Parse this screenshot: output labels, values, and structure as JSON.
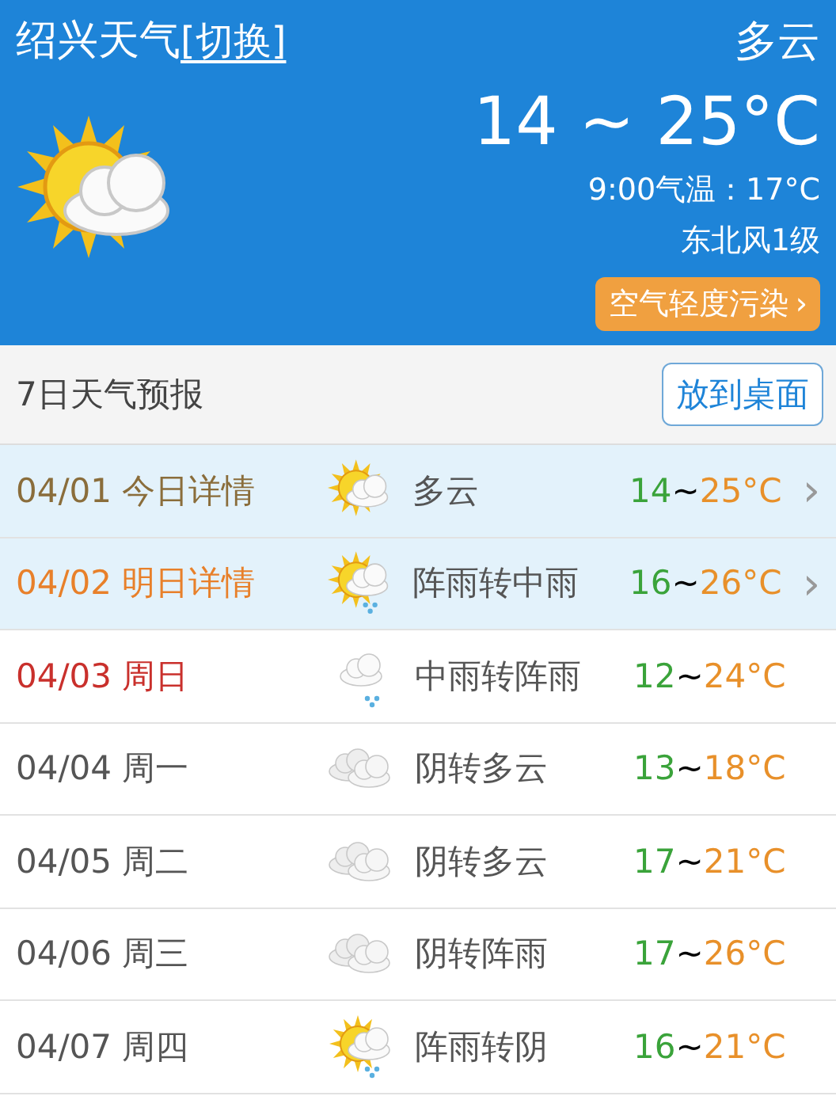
{
  "header": {
    "city": "绍兴天气",
    "switch_link": "[切换]",
    "condition": "多云",
    "temp_range": "14 ~ 25°C",
    "current_temp": "9:00气温：17°C",
    "wind": "东北风1级",
    "air_quality": "空气轻度污染",
    "air_chevron": "›",
    "kind": "sun_cloud"
  },
  "forecast_bar": {
    "title": "7日天气预报",
    "button": "放到桌面"
  },
  "days": [
    {
      "date": "04/01 今日详情",
      "color": "#8a6d3b",
      "highlight": true,
      "kind": "sun_cloud",
      "weather": "多云",
      "low": "14",
      "sep": "~",
      "high": "25°C",
      "chevron": "›"
    },
    {
      "date": "04/02 明日详情",
      "color": "#e8802a",
      "highlight": true,
      "kind": "sun_cloud_rain",
      "weather": "阵雨转中雨",
      "low": "16",
      "sep": "~",
      "high": "26°C",
      "chevron": "›"
    },
    {
      "date": "04/03 周日",
      "color": "#c9302c",
      "highlight": false,
      "kind": "cloud_rain",
      "weather": "中雨转阵雨",
      "low": "12",
      "sep": "~",
      "high": "24°C"
    },
    {
      "date": "04/04 周一",
      "color": "#555555",
      "highlight": false,
      "kind": "cloudy",
      "weather": "阴转多云",
      "low": "13",
      "sep": "~",
      "high": "18°C"
    },
    {
      "date": "04/05 周二",
      "color": "#555555",
      "highlight": false,
      "kind": "cloudy",
      "weather": "阴转多云",
      "low": "17",
      "sep": "~",
      "high": "21°C"
    },
    {
      "date": "04/06 周三",
      "color": "#555555",
      "highlight": false,
      "kind": "cloudy",
      "weather": "阴转阵雨",
      "low": "17",
      "sep": "~",
      "high": "26°C"
    },
    {
      "date": "04/07 周四",
      "color": "#555555",
      "highlight": false,
      "kind": "sun_cloud_rain",
      "weather": "阵雨转阴",
      "low": "16",
      "sep": "~",
      "high": "21°C"
    }
  ]
}
